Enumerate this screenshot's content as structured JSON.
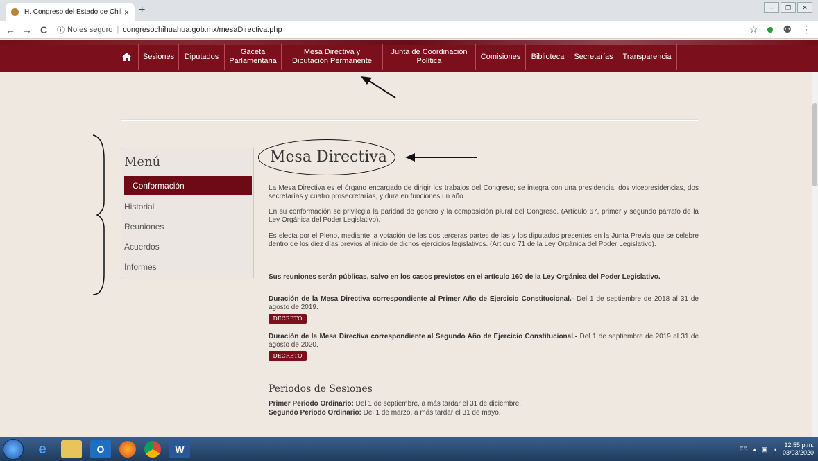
{
  "browser": {
    "tab_title": "H. Congreso del Estado de Chihu",
    "tab_close": "×",
    "new_tab": "+",
    "security_label": "No es seguro",
    "url": "congresochihuahua.gob.mx/mesaDirectiva.php",
    "nav_back": "←",
    "nav_forward": "→",
    "nav_reload": "C",
    "star": "☆",
    "account": "⚉",
    "more": "⋮"
  },
  "navbar": {
    "home_icon": "home-icon",
    "items": [
      "Sesiones",
      "Diputados",
      "Gaceta Parlamentaria",
      "Mesa Directiva y Diputación Permanente",
      "Junta de Coordinación Política",
      "Comisiones",
      "Biblioteca",
      "Secretarías",
      "Transparencia"
    ]
  },
  "sidebar": {
    "title": "Menú",
    "active": "Conformación",
    "items": [
      "Historial",
      "Reuniones",
      "Acuerdos",
      "Informes"
    ]
  },
  "main": {
    "heading": "Mesa Directiva",
    "p1": "La Mesa Directiva es el órgano encargado de dirigir los trabajos del Congreso; se integra con una presidencia, dos vicepresidencias, dos secretarías y cuatro prosecretarías, y dura en funciones un año.",
    "p2": "En su conformación se privilegia la paridad de género y la composición plural del Congreso. (Artículo 67, primer y segundo párrafo de la Ley Orgánica del Poder Legislativo).",
    "p3": "Es electa por el Pleno, mediante la votación de las dos terceras partes de las y los diputados presentes en la Junta Previa que se celebre dentro de los diez días previos al inicio de dichos ejercicios legislativos. (Artículo 71 de la Ley Orgánica del Poder Legislativo).",
    "p4": "Sus reuniones serán públicas, salvo en los casos previstos en el artículo 160 de la Ley Orgánica del Poder Legislativo.",
    "d1_bold": "Duración de la Mesa Directiva correspondiente al Primer Año de Ejercicio Constitucional.-",
    "d1_rest": " Del 1 de septiembre de 2018 al 31 de agosto de 2019.",
    "d2_bold": "Duración de la Mesa Directiva correspondiente al Segundo Año de Ejercicio Constitucional.-",
    "d2_rest": " Del 1 de septiembre de 2019 al 31 de agosto de 2020.",
    "decreto": "DECRETO",
    "periods_heading": "Periodos de Sesiones",
    "period1_bold": "Primer Periodo Ordinario:",
    "period1_rest": " Del 1 de septiembre, a más tardar el 31 de diciembre.",
    "period2_bold": "Segundo Periodo Ordinario:",
    "period2_rest": " Del 1 de marzo, a más tardar el 31 de mayo."
  },
  "taskbar": {
    "lang": "ES",
    "time": "12:55 p.m.",
    "date": "03/03/2020"
  }
}
